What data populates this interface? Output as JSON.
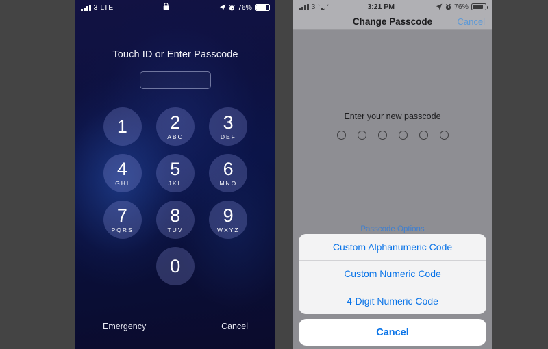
{
  "left_phone": {
    "status_bar": {
      "signal_icon": "signal-bars-icon",
      "carrier_number": "3",
      "network": "LTE",
      "lock_icon": "lock-icon",
      "location_icon": "location-arrow-icon",
      "alarm_icon": "alarm-clock-icon",
      "battery_percent": "76%",
      "battery_icon": "battery-icon"
    },
    "title": "Touch ID or Enter Passcode",
    "passcode_field_value": "",
    "keypad": [
      {
        "digit": "1",
        "letters": ""
      },
      {
        "digit": "2",
        "letters": "ABC"
      },
      {
        "digit": "3",
        "letters": "DEF"
      },
      {
        "digit": "4",
        "letters": "GHI"
      },
      {
        "digit": "5",
        "letters": "JKL"
      },
      {
        "digit": "6",
        "letters": "MNO"
      },
      {
        "digit": "7",
        "letters": "PQRS"
      },
      {
        "digit": "8",
        "letters": "TUV"
      },
      {
        "digit": "9",
        "letters": "WXYZ"
      },
      {
        "digit": "0",
        "letters": ""
      }
    ],
    "emergency_label": "Emergency",
    "cancel_label": "Cancel"
  },
  "right_phone": {
    "status_bar": {
      "signal_icon": "signal-bars-icon",
      "carrier_number": "3",
      "wifi_icon": "wifi-icon",
      "time": "3:21 PM",
      "location_icon": "location-arrow-icon",
      "alarm_icon": "alarm-clock-icon",
      "battery_percent": "76%",
      "battery_icon": "battery-icon"
    },
    "nav": {
      "title": "Change Passcode",
      "cancel_label": "Cancel"
    },
    "prompt": "Enter your new passcode",
    "dots_count": 6,
    "passcode_options_link": "Passcode Options",
    "action_sheet": {
      "options": [
        "Custom Alphanumeric Code",
        "Custom Numeric Code",
        "4-Digit Numeric Code"
      ],
      "cancel_label": "Cancel"
    }
  },
  "colors": {
    "page_background": "#444444",
    "lock_screen_navy": "#0b1140",
    "key_fill": "rgba(150,160,230,0.26)",
    "dimmed_gray": "#8e8e93",
    "status_gray": "#b0b0b4",
    "ios_blue": "#0a74e8",
    "dimmed_blue": "#5f9ad6",
    "sheet_background": "#f3f3f4"
  }
}
